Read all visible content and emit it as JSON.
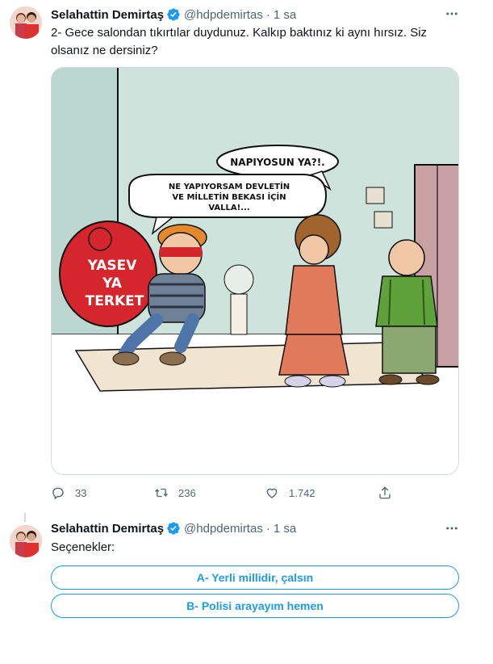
{
  "tweets": [
    {
      "author_name": "Selahattin Demirtaş",
      "handle": "@hdpdemirtas",
      "separator": "·",
      "time": "1 sa",
      "text": "2- Gece salondan tıkırtılar duydunuz. Kalkıp baktınız ki aynı hırsız. Siz olsanız ne dersiniz?",
      "media": {
        "bubble_woman": "NAPIYOSUN YA?!.",
        "bubble_thief": [
          "NE YAPIYORSAM DEVLETİN",
          "VE MİLLETİN BEKASI İÇİN",
          "VALLA!..."
        ],
        "sack_text": [
          "YASEV",
          "YA",
          "TERKET"
        ]
      },
      "actions": {
        "reply_count": "33",
        "retweet_count": "236",
        "like_count": "1.742"
      }
    },
    {
      "author_name": "Selahattin Demirtaş",
      "handle": "@hdpdemirtas",
      "separator": "·",
      "time": "1 sa",
      "text": "Seçenekler:",
      "poll_options": [
        "A- Yerli millidir, çalsın",
        "B- Polisi arayayım hemen"
      ]
    }
  ],
  "colors": {
    "accent": "#1d9bf0",
    "text_primary": "#0f1419",
    "text_secondary": "#536471",
    "border": "#cfd9de"
  },
  "icons": [
    "avatar",
    "verified-badge-icon",
    "more-icon",
    "reply-icon",
    "retweet-icon",
    "like-icon",
    "share-icon"
  ]
}
